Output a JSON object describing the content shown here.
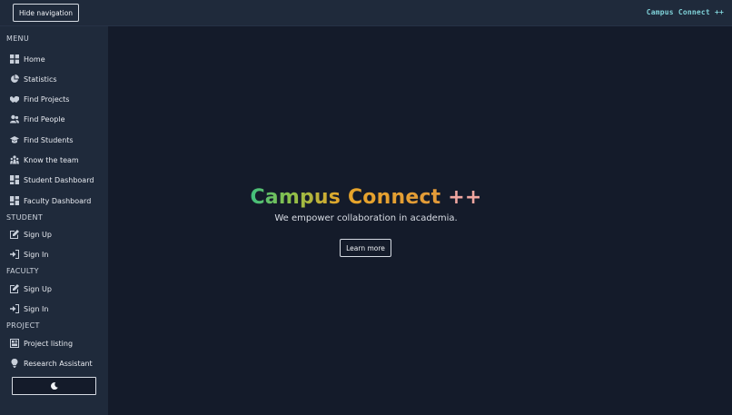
{
  "topbar": {
    "hide_nav_label": "Hide navigation",
    "brand": "Campus Connect ++"
  },
  "sidebar": {
    "sections": {
      "menu": "MENU",
      "student": "STUDENT",
      "faculty": "FACULTY",
      "project": "PROJECT"
    },
    "menu_items": [
      {
        "label": "Home",
        "icon": "grid-icon"
      },
      {
        "label": "Statistics",
        "icon": "pie-chart-icon"
      },
      {
        "label": "Find Projects",
        "icon": "handshake-icon"
      },
      {
        "label": "Find People",
        "icon": "users-icon"
      },
      {
        "label": "Find Students",
        "icon": "graduation-cap-icon"
      },
      {
        "label": "Know the team",
        "icon": "team-icon"
      },
      {
        "label": "Student Dashboard",
        "icon": "dashboard-icon"
      },
      {
        "label": "Faculty Dashboard",
        "icon": "dashboard-icon"
      }
    ],
    "student_items": [
      {
        "label": "Sign Up",
        "icon": "edit-icon"
      },
      {
        "label": "Sign In",
        "icon": "sign-in-icon"
      }
    ],
    "faculty_items": [
      {
        "label": "Sign Up",
        "icon": "edit-icon"
      },
      {
        "label": "Sign In",
        "icon": "sign-in-icon"
      }
    ],
    "project_items": [
      {
        "label": "Project listing",
        "icon": "listing-icon"
      },
      {
        "label": "Research Assistant",
        "icon": "lightbulb-icon"
      }
    ],
    "theme_toggle_icon": "moon-icon"
  },
  "hero": {
    "title_part1": "Campus",
    "title_part2": "Connect",
    "title_part3": "++",
    "subtitle": "We empower collaboration in academia.",
    "learn_more_label": "Learn more"
  }
}
